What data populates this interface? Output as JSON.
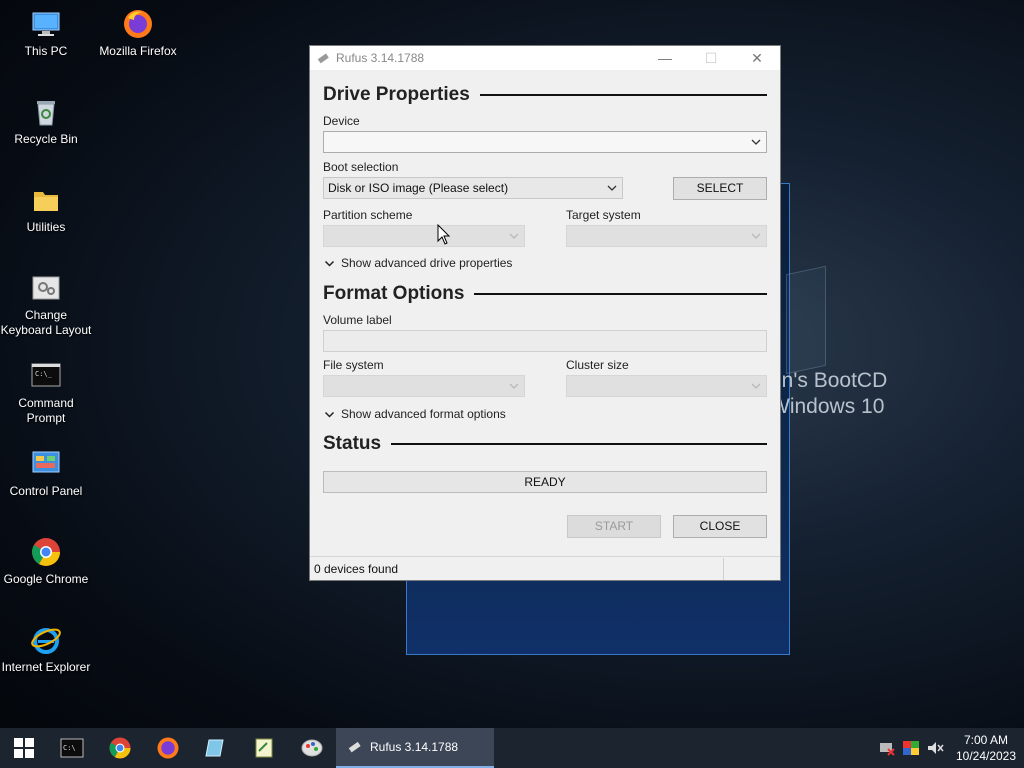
{
  "desktop": {
    "icons": [
      {
        "label": "This PC",
        "icon": "computer-icon"
      },
      {
        "label": "Mozilla Firefox",
        "icon": "firefox-icon"
      },
      {
        "label": "Recycle Bin",
        "icon": "recycle-bin-icon"
      },
      {
        "label": "Utilities",
        "icon": "folder-icon"
      },
      {
        "label": "Change Keyboard Layout",
        "icon": "keyboard-settings-icon"
      },
      {
        "label": "Command Prompt",
        "icon": "terminal-icon"
      },
      {
        "label": "Control Panel",
        "icon": "control-panel-icon"
      },
      {
        "label": "Google Chrome",
        "icon": "chrome-icon"
      },
      {
        "label": "Internet Explorer",
        "icon": "internet-explorer-icon"
      }
    ],
    "wallpaper_text": "en's BootCD\nWindows 10"
  },
  "window": {
    "title": "Rufus 3.14.1788",
    "minimize": "—",
    "maximize": "☐",
    "close": "✕"
  },
  "drive_properties": {
    "heading": "Drive Properties",
    "device_label": "Device",
    "device_value": "",
    "boot_selection_label": "Boot selection",
    "boot_selection_value": "Disk or ISO image (Please select)",
    "select_button": "SELECT",
    "partition_scheme_label": "Partition scheme",
    "partition_scheme_value": "",
    "target_system_label": "Target system",
    "target_system_value": "",
    "advanced_toggle": "Show advanced drive properties"
  },
  "format_options": {
    "heading": "Format Options",
    "volume_label_label": "Volume label",
    "volume_label_value": "",
    "file_system_label": "File system",
    "file_system_value": "",
    "cluster_size_label": "Cluster size",
    "cluster_size_value": "",
    "advanced_toggle": "Show advanced format options"
  },
  "status": {
    "heading": "Status",
    "progress_text": "READY",
    "start_button": "START",
    "close_button": "CLOSE",
    "footer_text": "0 devices found"
  },
  "taskbar": {
    "active_task": "Rufus 3.14.1788",
    "time": "7:00 AM",
    "date": "10/24/2023"
  },
  "colors": {
    "window_bg": "#f0f0f0",
    "taskbar_bg": "#1c2430",
    "accent": "#3a78c8"
  }
}
